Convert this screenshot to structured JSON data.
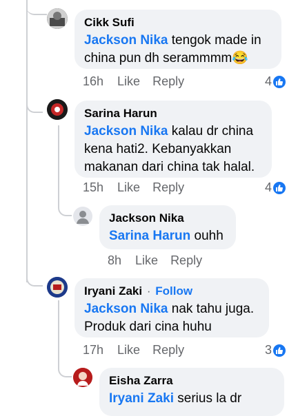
{
  "comments": [
    {
      "author": "Cikk Sufi",
      "mention": "Jackson Nika",
      "text": "tengok made in china pun dh serammmm😂",
      "time": "16h",
      "like_label": "Like",
      "reply_label": "Reply",
      "reaction_count": "4"
    },
    {
      "author": "Sarina Harun",
      "mention": "Jackson Nika",
      "text": "kalau dr china kena hati2. Kebanyakkan makanan dari china tak halal.",
      "time": "15h",
      "like_label": "Like",
      "reply_label": "Reply",
      "reaction_count": "4",
      "reply": {
        "author": "Jackson Nika",
        "mention": "Sarina Harun",
        "text": "ouhh",
        "time": "8h",
        "like_label": "Like",
        "reply_label": "Reply"
      }
    },
    {
      "author": "Iryani Zaki",
      "follow_label": "Follow",
      "mention": "Jackson Nika",
      "text": "nak tahu juga. Produk dari cina huhu",
      "time": "17h",
      "like_label": "Like",
      "reply_label": "Reply",
      "reaction_count": "3",
      "reply": {
        "author": "Eisha Zarra",
        "mention": "Iryani Zaki",
        "text": "serius la dr"
      }
    }
  ],
  "colors": {
    "link": "#1877f2",
    "bubble": "#f0f2f5",
    "meta": "#65676b",
    "thread_line": "#ced0d4"
  },
  "icons": [
    "like-thumb-icon",
    "default-avatar-icon"
  ]
}
